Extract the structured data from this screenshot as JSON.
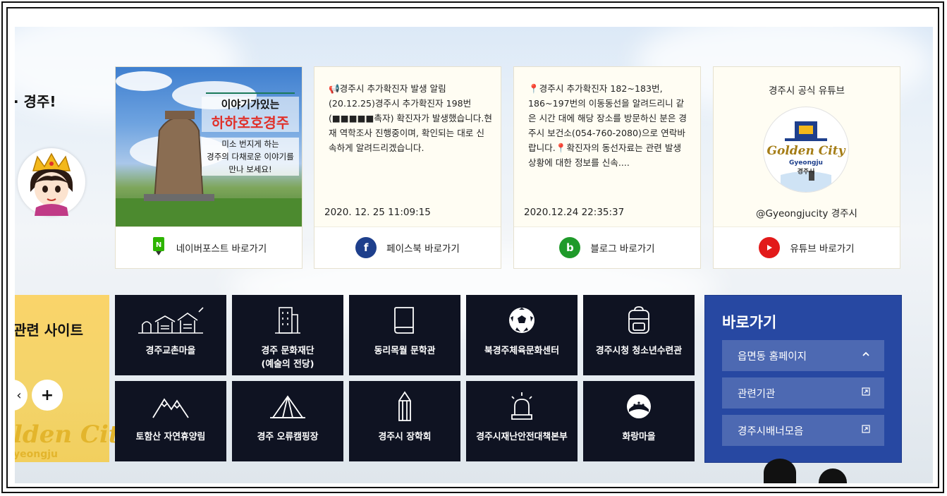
{
  "hero": {
    "headline": "· 경주!"
  },
  "cards": [
    {
      "type": "naver",
      "link_label": "네이버포스트 바로가기",
      "photo": {
        "line1": "이야기가있는",
        "line2": "하하호호경주",
        "line3": "미소 번지게 하는",
        "line4": "경주의 다채로운 이야기를",
        "line5": "만나 보세요!"
      }
    },
    {
      "type": "facebook",
      "post": "📢경주시 추가확진자 발생 알림 (20.12.25)경주시 추가확진자 198번 (■■■■■촉자) 확진자가 발생했습니다.현재 역학조사 진행중이며, 확인되는 대로 신속하게 알려드리겠습니다.",
      "date": "2020. 12. 25 11:09:15",
      "link_label": "페이스북 바로가기",
      "icon": "f"
    },
    {
      "type": "blog",
      "post": "📍경주시 추가확진자 182~183번, 186~197번의 이동동선을 알려드리니 같은 시간 대에 해당 장소를 방문하신 분은 경주시 보건소(054-760-2080)으로 연락바랍니다.📍확진자의 동선자료는 관련 발생 상황에 대한 정보를 신속....",
      "date": "2020.12.24 22:35:37",
      "link_label": "블로그 바로가기",
      "icon": "b"
    },
    {
      "type": "youtube",
      "heading": "경주시 공식 유튜브",
      "logo_text": "Golden City",
      "logo_sub1": "Gyeongju",
      "logo_sub2": "경주시",
      "handle": "@Gyeongjucity 경주시",
      "link_label": "유튜브 바로가기"
    }
  ],
  "related": {
    "title": "관련 사이트",
    "prev_label": "‹",
    "next_label": "+",
    "brand1": "lden City",
    "brand2": "yeongju"
  },
  "tiles": [
    {
      "label": "경주교촌마을",
      "icon": "village-icon"
    },
    {
      "label": "경주 문화재단\n(예술의 전당)",
      "icon": "building-icon"
    },
    {
      "label": "동리목월 문학관",
      "icon": "book-icon"
    },
    {
      "label": "북경주체육문화센터",
      "icon": "soccer-ball-icon"
    },
    {
      "label": "경주시청 청소년수련관",
      "icon": "backpack-icon"
    },
    {
      "label": "토함산 자연휴양림",
      "icon": "mountain-icon"
    },
    {
      "label": "경주 오류캠핑장",
      "icon": "tent-icon"
    },
    {
      "label": "경주시 장학회",
      "icon": "pencil-icon"
    },
    {
      "label": "경주시재난안전대책본부",
      "icon": "siren-icon"
    },
    {
      "label": "화랑마을",
      "icon": "hat-icon"
    }
  ],
  "quick": {
    "title": "바로가기",
    "items": [
      {
        "label": "읍면동 홈페이지",
        "arrow": "⌃"
      },
      {
        "label": "관련기관",
        "arrow": "↗"
      },
      {
        "label": "경주시배너모음",
        "arrow": "↗"
      }
    ]
  },
  "colors": {
    "tile_bg": "#0f1322",
    "quick_bg": "#2748a2",
    "facebook": "#1e3f8c",
    "blog": "#1f9a2a",
    "youtube": "#e21a1a",
    "naver": "#2db400"
  }
}
